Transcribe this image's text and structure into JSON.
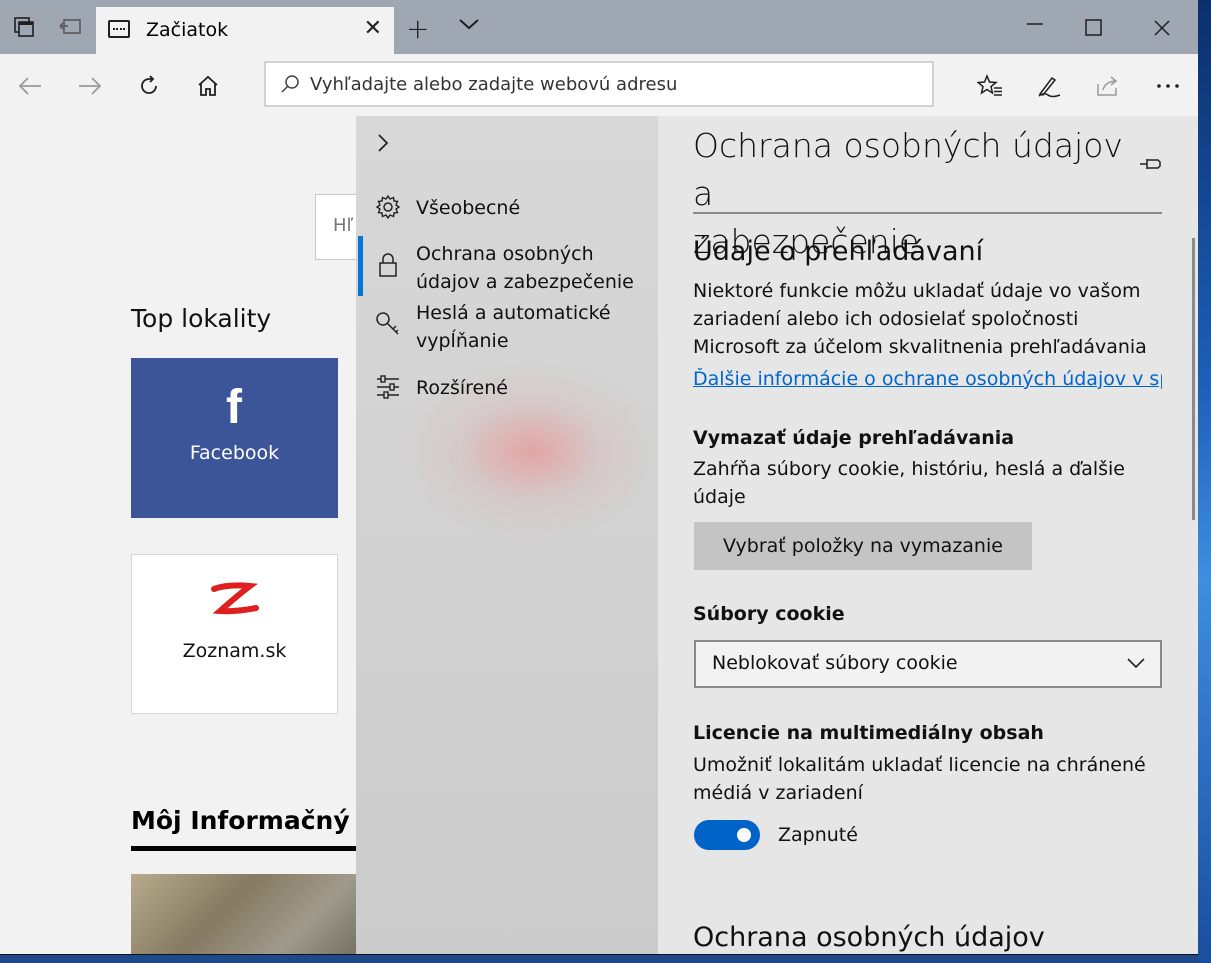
{
  "browser": {
    "tab": {
      "title": "Začiatok"
    },
    "address_placeholder": "Vyhľadajte alebo zadajte webovú adresu"
  },
  "page": {
    "search_partial": "Hľ",
    "top_sites_title": "Top lokality",
    "tiles": [
      {
        "label": "Facebook",
        "icon": "facebook-f-icon",
        "color": "#3b5598"
      },
      {
        "label": "Zoznam.sk",
        "icon": "zoznam-z-icon",
        "color": "#e02020"
      }
    ],
    "news_heading": "Môj Informačný K"
  },
  "settings_nav": {
    "items": [
      {
        "label": "Všeobecné",
        "icon": "gear-icon"
      },
      {
        "label": "Ochrana osobných údajov a zabezpečenie",
        "line1": "Ochrana osobných",
        "line2": "údajov a zabezpečenie",
        "icon": "lock-icon",
        "active": true
      },
      {
        "label": "Heslá a automatické vypĺňanie",
        "line1": "Heslá a automatické",
        "line2": "vypĺňanie",
        "icon": "key-icon"
      },
      {
        "label": "Rozšírené",
        "icon": "sliders-icon"
      }
    ]
  },
  "settings": {
    "title_line1": "Ochrana osobných údajov a",
    "title_line2": "zabezpečenie",
    "browsing_data": {
      "heading": "Údaje o prehľadávaní",
      "desc_line1": "Niektoré funkcie môžu ukladať údaje vo vašom",
      "desc_line2": "zariadení alebo ich odosielať spoločnosti",
      "desc_line3": "Microsoft za účelom skvalitnenia prehľadávania",
      "link": "Ďalšie informácie o ochrane osobných údajov v spo"
    },
    "clear_data": {
      "heading": "Vymazať údaje prehľadávania",
      "desc_line1": "Zahŕňa súbory cookie, históriu, heslá a ďalšie",
      "desc_line2": "údaje",
      "button": "Vybrať položky na vymazanie"
    },
    "cookies": {
      "heading": "Súbory cookie",
      "selected": "Neblokovať súbory cookie"
    },
    "media_licenses": {
      "heading": "Licencie na multimediálny obsah",
      "desc_line1": "Umožniť lokalitám ukladať licencie na chránené",
      "desc_line2": "médiá v zariadení",
      "toggle_on": true,
      "toggle_label": "Zapnuté"
    },
    "next_section_heading": "Ochrana osobných údajov"
  },
  "colors": {
    "accent": "#0078d7",
    "toggle": "#0063c7",
    "link": "#0066cc"
  }
}
